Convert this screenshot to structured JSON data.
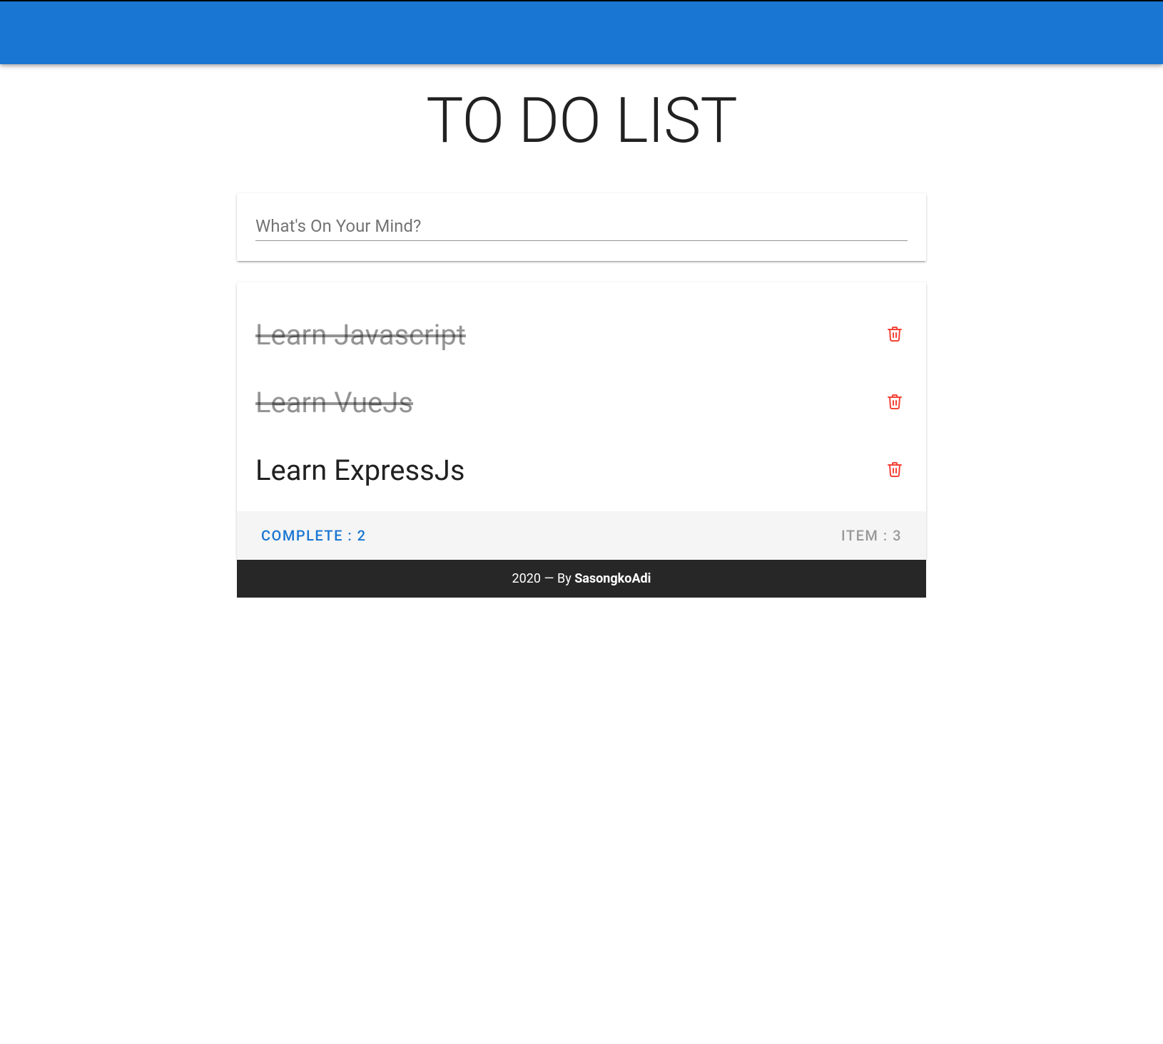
{
  "header": {
    "title": "TO DO LIST"
  },
  "input": {
    "placeholder": "What's On Your Mind?",
    "value": ""
  },
  "todos": [
    {
      "text": "Learn Javascript",
      "done": true
    },
    {
      "text": "Learn VueJs",
      "done": true
    },
    {
      "text": "Learn ExpressJs",
      "done": false
    }
  ],
  "status": {
    "complete_label": "COMPLETE : ",
    "complete_count": "2",
    "item_label": "ITEM : ",
    "item_count": "3"
  },
  "footer": {
    "year": "2020",
    "sep": " — By ",
    "author": "SasongkoAdi"
  },
  "colors": {
    "primary": "#1976d2",
    "danger": "#f44336",
    "footer_bg": "#272727"
  }
}
